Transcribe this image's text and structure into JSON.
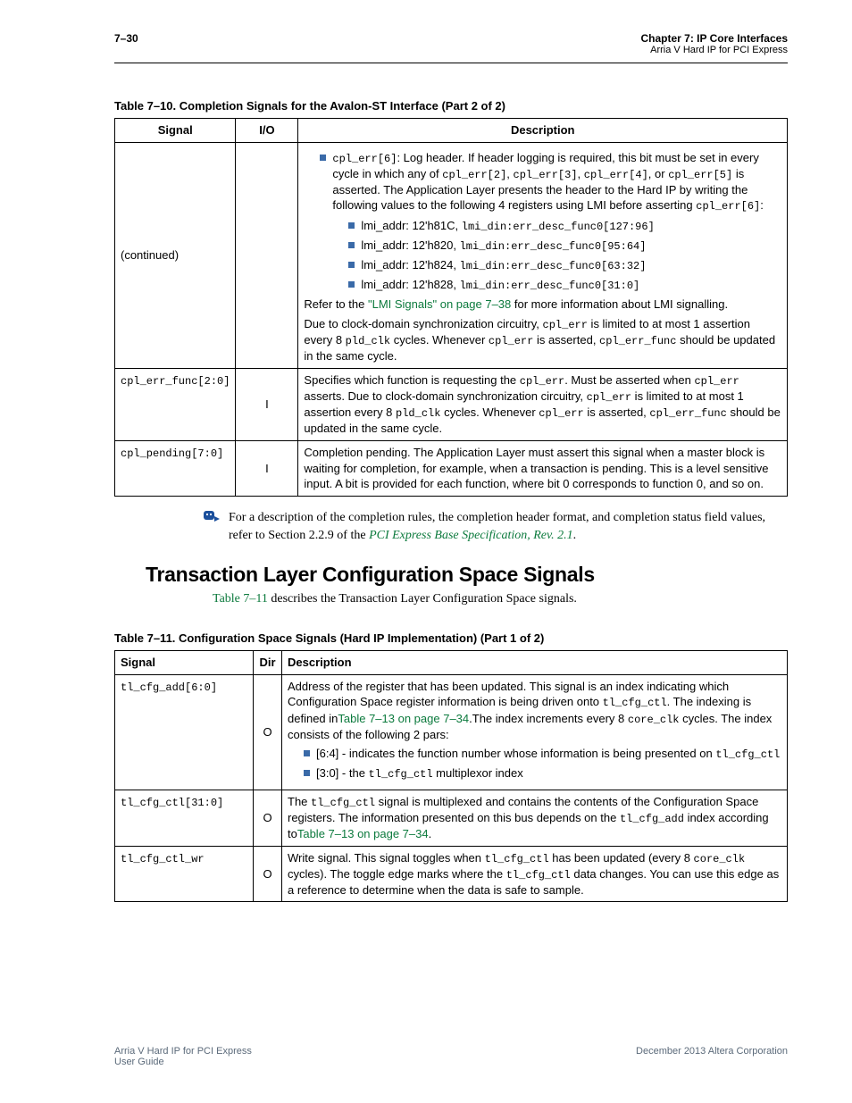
{
  "header": {
    "page_no": "7–30",
    "chapter": "Chapter 7: IP Core Interfaces",
    "subtitle": "Arria V Hard IP for PCI Express"
  },
  "table1": {
    "caption": "Table 7–10. Completion Signals for the Avalon-ST Interface  (Part 2 of 2)",
    "head": {
      "c1": "Signal",
      "c2": "I/O",
      "c3": "Description"
    },
    "rows": [
      {
        "signal": "(continued)",
        "io": "",
        "desc": {
          "b1_pre": "cpl_err[6]",
          "b1_text": ": Log header. If header logging is required, this bit must be set in every cycle in which any of ",
          "b1_c1": "cpl_err[2]",
          "b1_sep1": ", ",
          "b1_c2": "cpl_err[3]",
          "b1_sep2": ", ",
          "b1_c3": "cpl_err[4]",
          "b1_sep3": ", or ",
          "b1_c4": "cpl_err[5]",
          "b1_tail": " is asserted. The Application Layer presents the header to the Hard IP by writing the following values to the following 4 registers using LMI before asserting ",
          "b1_c5": "cpl_err[6]",
          "b1_colon": ":",
          "r1a": "lmi_addr: 12'h81C, ",
          "r1b": "lmi_din:err_desc_func0[127:96]",
          "r2a": "lmi_addr: 12'h820, ",
          "r2b": "lmi_din:err_desc_func0[95:64]",
          "r3a": "lmi_addr: 12'h824, ",
          "r3b": "lmi_din:err_desc_func0[63:32]",
          "r4a": "lmi_addr: 12'h828, ",
          "r4b": "lmi_din:err_desc_func0[31:0]",
          "refer1": "Refer to the ",
          "refer_link": "\"LMI Signals\" on page 7–38",
          "refer2": " for more information about LMI signalling.",
          "due1": "Due to clock-domain synchronization circuitry, ",
          "due_c1": "cpl_err",
          "due2": " is limited to at most 1 assertion every 8 ",
          "due_c2": "pld_clk",
          "due3": " cycles.  Whenever ",
          "due_c3": "cpl_err",
          "due4": " is asserted, ",
          "due_c4": "cpl_err_func",
          "due5": " should be updated in the same cycle."
        }
      },
      {
        "signal": "cpl_err_func[2:0]",
        "io": "I",
        "desc": {
          "t1": "Specifies which function is requesting the ",
          "c1": "cpl_err",
          "t2": ". Must be asserted when ",
          "c2": "cpl_err",
          "t3": " asserts. Due to clock-domain synchronization circuitry, ",
          "c3": "cpl_err",
          "t4": " is limited to at most 1 assertion every 8 ",
          "c4": "pld_clk",
          "t5": " cycles.  Whenever ",
          "c5": "cpl_err",
          "t6": " is asserted, ",
          "c6": "cpl_err_func",
          "t7": " should be updated in the same cycle."
        }
      },
      {
        "signal": "cpl_pending[7:0]",
        "io": "I",
        "desc": {
          "text": "Completion pending. The Application Layer must assert this signal when a master block is waiting for completion, for example, when a transaction is pending. This is a level sensitive input. A bit is provided for each function, where bit 0 corresponds to function 0, and so on."
        }
      }
    ]
  },
  "note": {
    "t1": "For a description of the completion rules, the completion header format, and completion status field values, refer to Section 2.2.9 of the ",
    "link": "PCI Express Base Specification, Rev. 2.1",
    "t2": "."
  },
  "section": {
    "title": "Transaction Layer Configuration Space Signals",
    "intro_link": "Table 7–11",
    "intro_rest": " describes the Transaction Layer Configuration Space signals."
  },
  "table2": {
    "caption": "Table 7–11. Configuration Space Signals (Hard IP Implementation)   (Part 1 of 2)",
    "head": {
      "c1": "Signal",
      "c2": "Dir",
      "c3": "Description"
    },
    "rows": [
      {
        "signal": "tl_cfg_add[6:0]",
        "dir": "O",
        "desc": {
          "t1": "Address of the register that has been updated. This signal is an index indicating which Configuration Space register information is being driven onto ",
          "c1": "tl_cfg_ctl",
          "t2": ". The indexing is defined in",
          "link1": "Table 7–13 on page 7–34",
          "t3": ".The index increments every 8 ",
          "c2": "core_clk",
          "t4": " cycles. The index consists of the following 2 pars:",
          "b1a": "[6:4] - indicates the function number whose information is being presented on ",
          "b1b": "tl_cfg_ctl",
          "b2a": "[3:0] - the ",
          "b2b": "tl_cfg_ctl",
          "b2c": " multiplexor index"
        }
      },
      {
        "signal": "tl_cfg_ctl[31:0]",
        "dir": "O",
        "desc": {
          "t1": "The ",
          "c1": "tl_cfg_ctl",
          "t2": " signal is multiplexed and contains the contents of the Configuration Space registers. The information presented on this bus depends on the ",
          "c2": "tl_cfg_add",
          "t3": " index according to",
          "link1": "Table 7–13 on page 7–34",
          "t4": "."
        }
      },
      {
        "signal": "tl_cfg_ctl_wr",
        "dir": "O",
        "desc": {
          "t1": "Write signal. This signal toggles when ",
          "c1": "tl_cfg_ctl",
          "t2": " has been updated (every 8 ",
          "c2": "core_clk",
          "t3": " cycles). The toggle edge marks where the ",
          "c3": "tl_cfg_ctl",
          "t4": " data changes. You can use this edge as a reference to determine when the data is safe to sample."
        }
      }
    ]
  },
  "footer": {
    "left1": "Arria V Hard IP for PCI Express",
    "left2": "User Guide",
    "right": "December 2013   Altera Corporation"
  }
}
